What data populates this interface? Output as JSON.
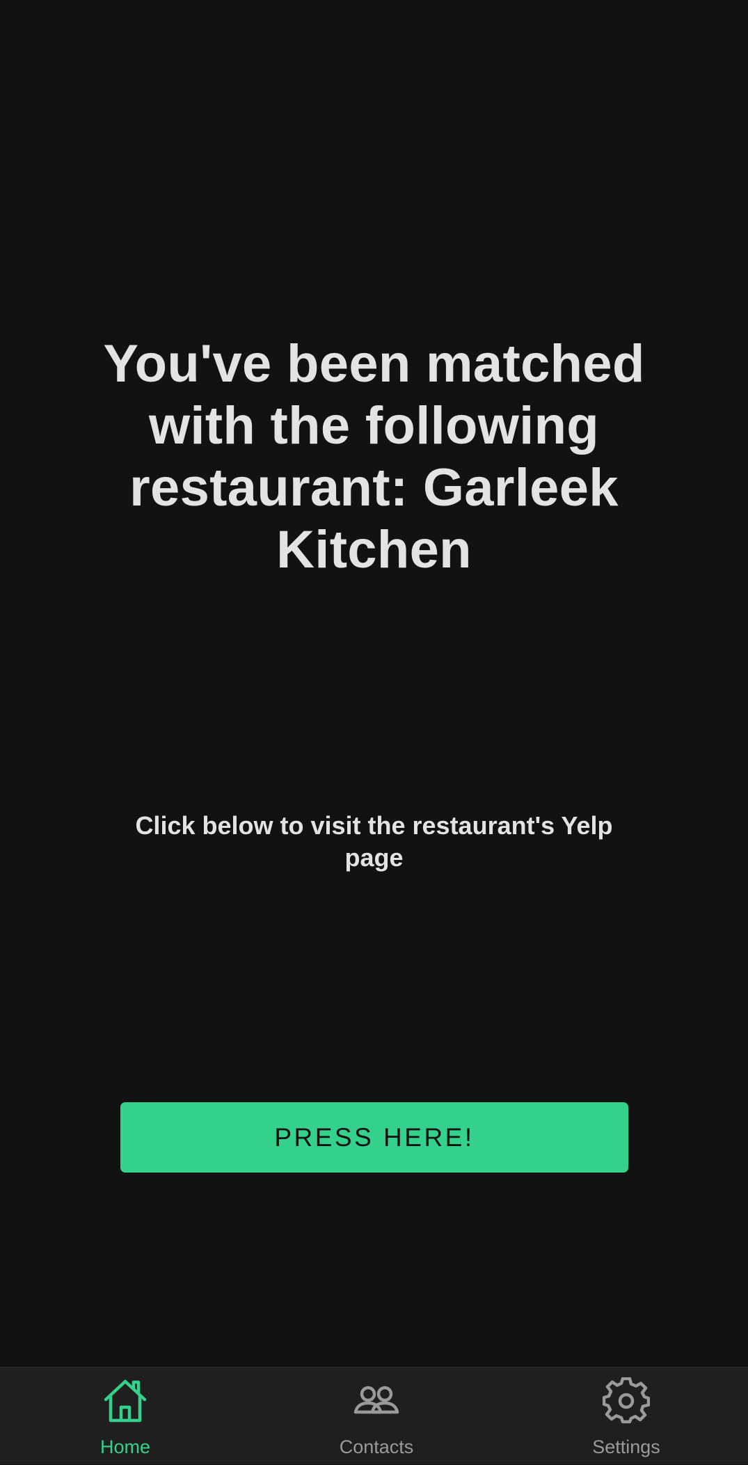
{
  "main": {
    "match_title": "You've been matched with the following restaurant: Garleek Kitchen",
    "subtitle": "Click below to visit the restaurant's Yelp page",
    "button_label": "PRESS HERE!"
  },
  "bottom_nav": {
    "items": [
      {
        "label": "Home",
        "icon": "home-icon",
        "active": true
      },
      {
        "label": "Contacts",
        "icon": "contacts-icon",
        "active": false
      },
      {
        "label": "Settings",
        "icon": "gear-icon",
        "active": false
      }
    ]
  },
  "colors": {
    "background": "#121212",
    "accent": "#34d18c",
    "text": "#e3e3e3",
    "nav_background": "#1f1f1f",
    "nav_inactive": "#9a9a9a"
  }
}
